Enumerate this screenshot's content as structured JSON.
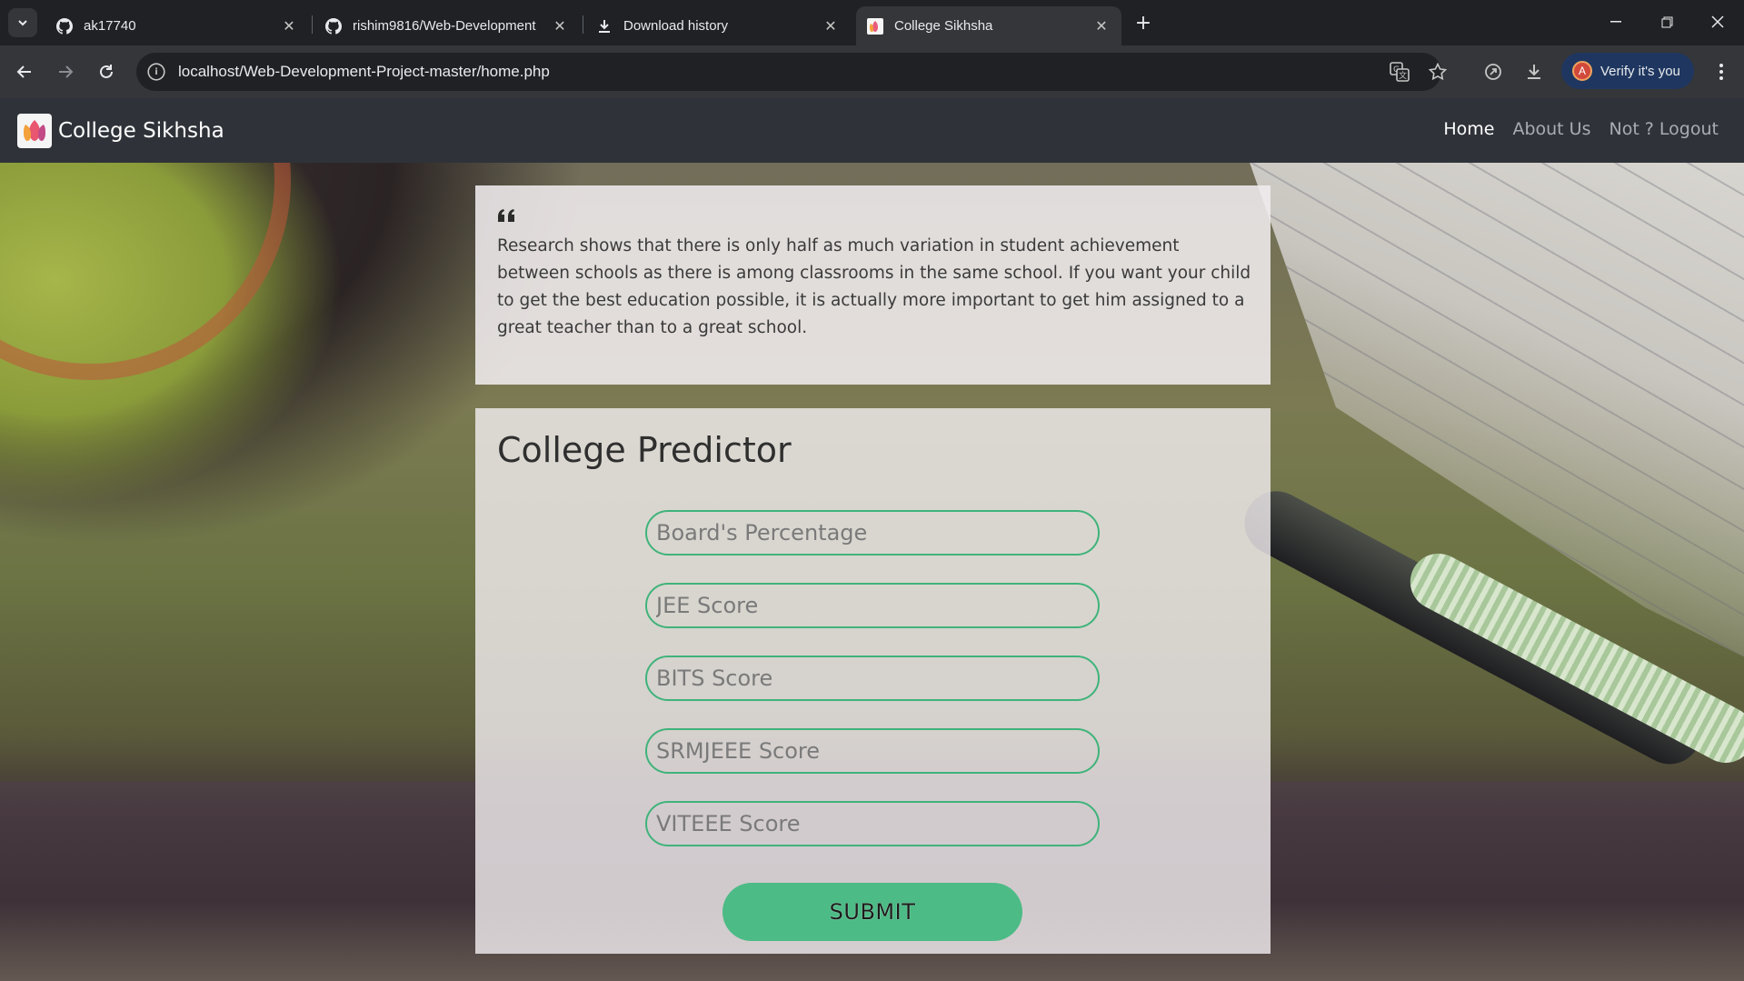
{
  "browser": {
    "tabs": [
      {
        "title": "ak17740",
        "icon": "github-icon"
      },
      {
        "title": "rishim9816/Web-Development",
        "icon": "github-icon"
      },
      {
        "title": "Download history",
        "icon": "download-icon"
      },
      {
        "title": "College Sikhsha",
        "icon": "college-sikhsha-favicon",
        "active": true
      }
    ],
    "url": "localhost/Web-Development-Project-master/home.php",
    "profile_label": "Verify it's you",
    "profile_initial": "A"
  },
  "navbar": {
    "brand": "College Sikhsha",
    "links": [
      {
        "label": "Home",
        "active": true
      },
      {
        "label": "About Us"
      },
      {
        "label": "Not ? Logout"
      }
    ]
  },
  "quote": {
    "text": "Research shows that there is only half as much variation in student achievement between schools as there is among classrooms in the same school. If you want your child to get the best education possible, it is actually more important to get him assigned to a great teacher than to a great school."
  },
  "predictor": {
    "title": "College Predictor",
    "fields": [
      {
        "placeholder": "Board's Percentage"
      },
      {
        "placeholder": "JEE Score"
      },
      {
        "placeholder": "BITS Score"
      },
      {
        "placeholder": "SRMJEEE Score"
      },
      {
        "placeholder": "VITEEE Score"
      }
    ],
    "submit_label": "SUBMIT"
  },
  "colors": {
    "accent_green": "#4cbb85",
    "field_border": "#3fb37a",
    "navbar_bg": "#2f3339"
  }
}
